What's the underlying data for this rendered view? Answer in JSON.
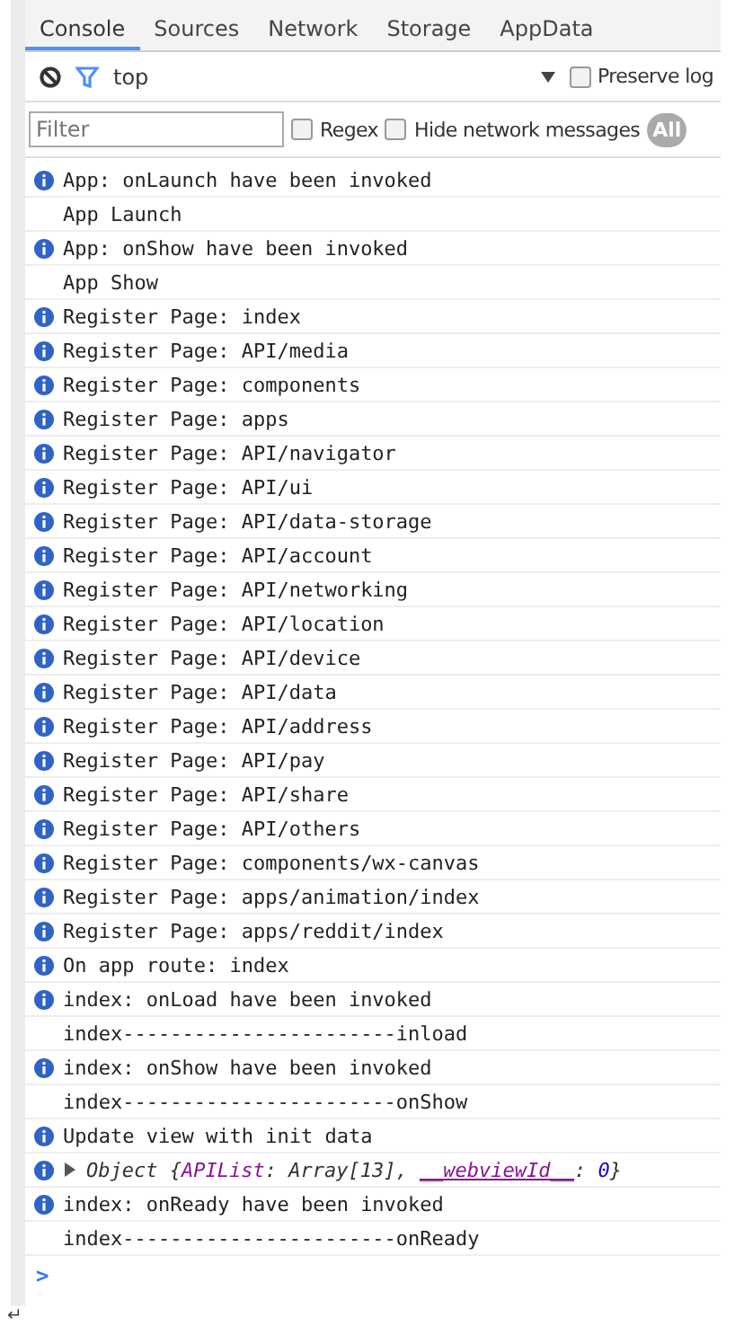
{
  "tabs": [
    {
      "label": "Console",
      "selected": true
    },
    {
      "label": "Sources",
      "selected": false
    },
    {
      "label": "Network",
      "selected": false
    },
    {
      "label": "Storage",
      "selected": false
    },
    {
      "label": "AppData",
      "selected": false
    }
  ],
  "toolbar": {
    "context": "top",
    "preserve_log": {
      "label": "Preserve log",
      "checked": false
    }
  },
  "filter": {
    "placeholder": "Filter",
    "regex": {
      "label": "Regex",
      "checked": false
    },
    "hide_network": {
      "label": "Hide network messages",
      "checked": false
    },
    "level_button": "All"
  },
  "logs": [
    {
      "kind": "info",
      "text": "App: onLaunch have been invoked"
    },
    {
      "kind": "plain",
      "text": "App Launch"
    },
    {
      "kind": "info",
      "text": "App: onShow have been invoked"
    },
    {
      "kind": "plain",
      "text": "App Show"
    },
    {
      "kind": "info",
      "text": "Register Page: index"
    },
    {
      "kind": "info",
      "text": "Register Page: API/media"
    },
    {
      "kind": "info",
      "text": "Register Page: components"
    },
    {
      "kind": "info",
      "text": "Register Page: apps"
    },
    {
      "kind": "info",
      "text": "Register Page: API/navigator"
    },
    {
      "kind": "info",
      "text": "Register Page: API/ui"
    },
    {
      "kind": "info",
      "text": "Register Page: API/data-storage"
    },
    {
      "kind": "info",
      "text": "Register Page: API/account"
    },
    {
      "kind": "info",
      "text": "Register Page: API/networking"
    },
    {
      "kind": "info",
      "text": "Register Page: API/location"
    },
    {
      "kind": "info",
      "text": "Register Page: API/device"
    },
    {
      "kind": "info",
      "text": "Register Page: API/data"
    },
    {
      "kind": "info",
      "text": "Register Page: API/address"
    },
    {
      "kind": "info",
      "text": "Register Page: API/pay"
    },
    {
      "kind": "info",
      "text": "Register Page: API/share"
    },
    {
      "kind": "info",
      "text": "Register Page: API/others"
    },
    {
      "kind": "info",
      "text": "Register Page: components/wx-canvas"
    },
    {
      "kind": "info",
      "text": "Register Page: apps/animation/index"
    },
    {
      "kind": "info",
      "text": "Register Page: apps/reddit/index"
    },
    {
      "kind": "info",
      "text": "On app route: index"
    },
    {
      "kind": "info",
      "text": "index: onLoad have been invoked"
    },
    {
      "kind": "plain",
      "text": "index-----------------------inload"
    },
    {
      "kind": "info",
      "text": "index: onShow have been invoked"
    },
    {
      "kind": "plain",
      "text": "index-----------------------onShow"
    },
    {
      "kind": "info",
      "text": "Update view with init data"
    },
    {
      "kind": "object",
      "expanded": false,
      "segments": [
        {
          "kind": "plain",
          "text": "Object {"
        },
        {
          "kind": "key",
          "text": "APIList"
        },
        {
          "kind": "plain",
          "text": ": Array[13], "
        },
        {
          "kind": "key",
          "text": "__webviewId__"
        },
        {
          "kind": "plain",
          "text": ": "
        },
        {
          "kind": "number",
          "text": "0"
        },
        {
          "kind": "plain",
          "text": "}"
        }
      ]
    },
    {
      "kind": "info",
      "text": "index: onReady have been invoked"
    },
    {
      "kind": "plain",
      "text": "index-----------------------onReady"
    }
  ],
  "prompt": ">",
  "footer_mark": "↵"
}
